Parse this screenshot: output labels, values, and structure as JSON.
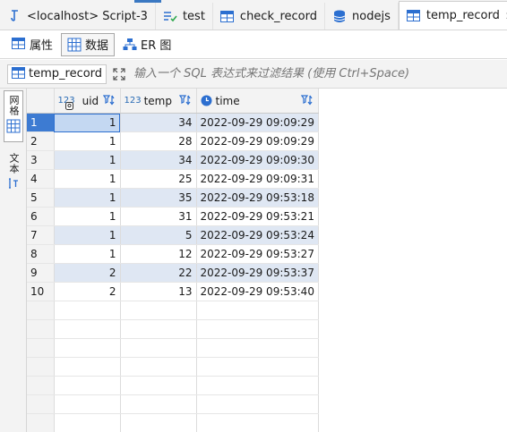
{
  "editor_tabs": [
    {
      "label": "<localhost> Script-3",
      "icon": "sql-script-icon",
      "active": false
    },
    {
      "label": "test",
      "icon": "checklist-icon",
      "active": false
    },
    {
      "label": "check_record",
      "icon": "table-icon",
      "active": false
    },
    {
      "label": "nodejs",
      "icon": "database-icon",
      "active": false
    },
    {
      "label": "temp_record",
      "icon": "table-icon",
      "active": true,
      "close": "✕"
    }
  ],
  "sub_tabs": [
    {
      "label": "属性",
      "icon": "properties-icon",
      "active": false
    },
    {
      "label": "数据",
      "icon": "data-icon",
      "active": true
    },
    {
      "label": "ER 图",
      "icon": "er-diagram-icon",
      "active": false
    }
  ],
  "filter": {
    "table_name": "temp_record",
    "placeholder": "输入一个 SQL 表达式来过滤结果 (使用 Ctrl+Space)"
  },
  "rail": {
    "grid_label": "网格",
    "text_label": "文本"
  },
  "columns": [
    {
      "name": "uid",
      "type": "123",
      "type_icon": "key-number-icon"
    },
    {
      "name": "temp",
      "type": "123",
      "type_icon": "number-type-icon"
    },
    {
      "name": "time",
      "type": "",
      "type_icon": "clock-icon"
    }
  ],
  "rows": [
    {
      "n": "1",
      "uid": "1",
      "temp": "34",
      "time": "2022-09-29 09:09:29"
    },
    {
      "n": "2",
      "uid": "1",
      "temp": "28",
      "time": "2022-09-29 09:09:29"
    },
    {
      "n": "3",
      "uid": "1",
      "temp": "34",
      "time": "2022-09-29 09:09:30"
    },
    {
      "n": "4",
      "uid": "1",
      "temp": "25",
      "time": "2022-09-29 09:09:31"
    },
    {
      "n": "5",
      "uid": "1",
      "temp": "35",
      "time": "2022-09-29 09:53:18"
    },
    {
      "n": "6",
      "uid": "1",
      "temp": "31",
      "time": "2022-09-29 09:53:21"
    },
    {
      "n": "7",
      "uid": "1",
      "temp": "5",
      "time": "2022-09-29 09:53:24"
    },
    {
      "n": "8",
      "uid": "1",
      "temp": "12",
      "time": "2022-09-29 09:53:27"
    },
    {
      "n": "9",
      "uid": "2",
      "temp": "22",
      "time": "2022-09-29 09:53:37"
    },
    {
      "n": "10",
      "uid": "2",
      "temp": "13",
      "time": "2022-09-29 09:53:40"
    }
  ],
  "colors": {
    "accent": "#3a78c2",
    "selected_row_header": "#3d7bd2",
    "alt_row": "#dfe7f3",
    "selected_cell": "#c4d8f2"
  }
}
